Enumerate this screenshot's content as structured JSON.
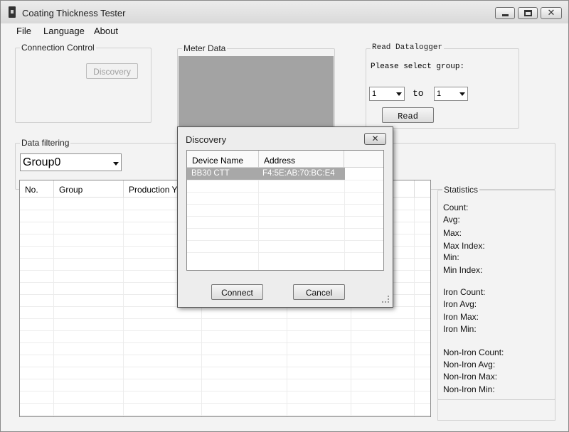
{
  "window": {
    "title": "Coating Thickness Tester"
  },
  "menu": {
    "file": "File",
    "language": "Language",
    "about": "About"
  },
  "connection": {
    "label": "Connection Control",
    "discovery_button": "Discovery"
  },
  "meter": {
    "label": "Meter Data"
  },
  "datalogger": {
    "label": "Read Datalogger",
    "prompt": "Please select group:",
    "from": "1",
    "to_label": "to",
    "to": "1",
    "read_button": "Read"
  },
  "filter": {
    "label": "Data filtering",
    "group": "Group0"
  },
  "table": {
    "columns": [
      "No.",
      "Group",
      "Production Yea"
    ]
  },
  "statistics": {
    "label": "Statistics",
    "count": "Count:",
    "avg": "Avg:",
    "max": "Max:",
    "max_index": "Max Index:",
    "min": "Min:",
    "min_index": "Min Index:",
    "iron_count": "Iron Count:",
    "iron_avg": "Iron Avg:",
    "iron_max": "Iron Max:",
    "iron_min": "Iron Min:",
    "noniron_count": "Non-Iron Count:",
    "noniron_avg": "Non-Iron Avg:",
    "noniron_max": "Non-Iron Max:",
    "noniron_min": "Non-Iron Min:"
  },
  "dialog": {
    "title": "Discovery",
    "columns": {
      "device_name": "Device Name",
      "address": "Address"
    },
    "devices": [
      {
        "name": "BB30 CTT",
        "address": "F4:5E:AB:70:BC:E4"
      }
    ],
    "connect_button": "Connect",
    "cancel_button": "Cancel"
  }
}
